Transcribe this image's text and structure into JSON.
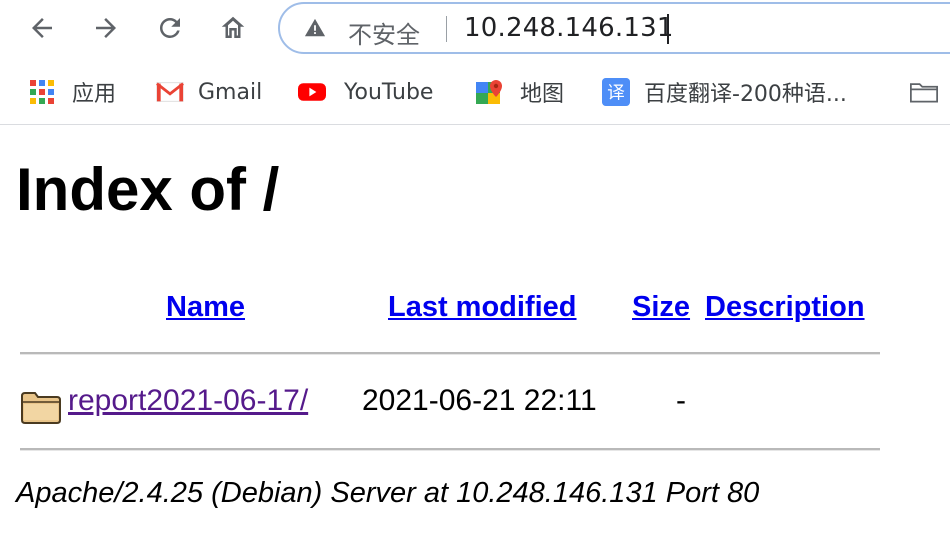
{
  "browser": {
    "nav": {
      "back_icon": "arrow-left-icon",
      "forward_icon": "arrow-right-icon",
      "reload_icon": "reload-icon",
      "home_icon": "home-icon"
    },
    "omnibox": {
      "security_label": "不安全",
      "url": "10.248.146.131",
      "warning_icon": "warning-triangle-icon"
    },
    "bookmarks": [
      {
        "label": "应用",
        "icon": "apps-grid-icon"
      },
      {
        "label": "Gmail",
        "icon": "gmail-icon"
      },
      {
        "label": "YouTube",
        "icon": "youtube-icon"
      },
      {
        "label": "地图",
        "icon": "maps-icon"
      },
      {
        "label": "百度翻译-200种语...",
        "icon": "baidu-translate-icon"
      },
      {
        "label": "",
        "icon": "folder-icon"
      }
    ]
  },
  "page": {
    "title": "Index of /",
    "columns": {
      "name": "Name",
      "last_modified": "Last modified",
      "size": "Size",
      "description": "Description"
    },
    "rows": [
      {
        "name": "report2021-06-17/",
        "last_modified": "2021-06-21 22:11",
        "size": "-",
        "description": "",
        "icon": "folder-icon"
      }
    ],
    "footer": "Apache/2.4.25 (Debian) Server at 10.248.146.131 Port 80"
  },
  "colors": {
    "link": "#0000ee",
    "visited_link": "#551a8b",
    "omnibox_border": "#9fbde8"
  }
}
